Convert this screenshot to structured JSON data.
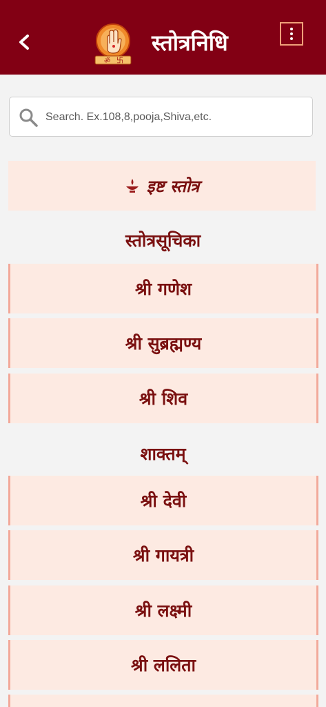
{
  "appbar": {
    "back_glyph": "<",
    "title": "स्तोत्रनिधि",
    "logo_text": "ॐ",
    "logo_text2": "卐"
  },
  "search": {
    "placeholder": "Search. Ex.108,8,pooja,Shiva,etc."
  },
  "favorites": {
    "label": "इष्ट स्तोत्र"
  },
  "sections": [
    {
      "heading": "स्तोत्रसूचिका",
      "items": [
        "श्री गणेश",
        "श्री सुब्रह्मण्य",
        "श्री शिव"
      ]
    },
    {
      "heading": "शाक्तम्",
      "items": [
        "श्री देवी",
        "श्री गायत्री",
        "श्री लक्ष्मी",
        "श्री ललिता"
      ]
    }
  ],
  "colors": {
    "appbar": "#820014",
    "card": "#fdeae2",
    "accent_text": "#7a1010"
  }
}
